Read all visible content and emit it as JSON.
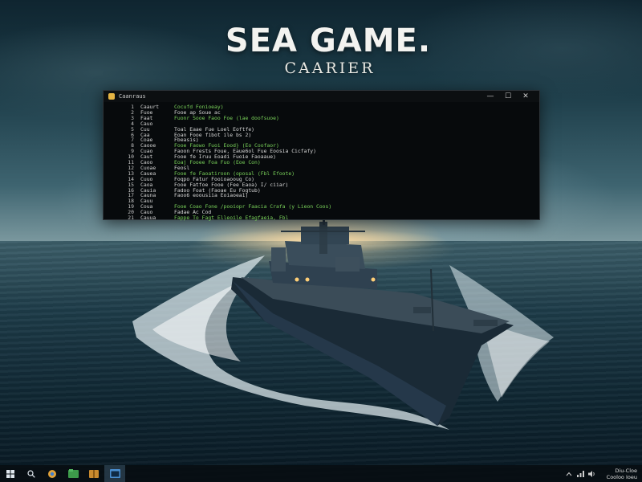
{
  "title": {
    "main": "SEA GAME.",
    "subtitle": "CAARIER"
  },
  "console": {
    "window_title": "Caanraus",
    "controls": {
      "minimize": "—",
      "maximize": "☐",
      "close": "✕"
    },
    "lines": [
      {
        "num": "1",
        "code": "Caaurt",
        "text": "Cocufd Fonioeay)",
        "green": true
      },
      {
        "num": "2",
        "code": "Fuoe",
        "text": "Fooe ap Soue ac",
        "green": false
      },
      {
        "num": "3",
        "code": "Faat",
        "text": "Fuonr Sooe Faoo Foe (lae doofsuoe)",
        "green": true
      },
      {
        "num": "4",
        "code": "Cauo",
        "text": "",
        "green": false
      },
      {
        "num": "5",
        "code": "Cuu",
        "text": "Toal Eaae Fue Loel Eoftfe)",
        "green": false
      },
      {
        "num": "6",
        "code": "Caa",
        "text": "Eoan Fooe fibot ile bs 2)",
        "green": false
      },
      {
        "num": "7",
        "code": "Coae",
        "text": "Fbeasis)",
        "green": false
      },
      {
        "num": "8",
        "code": "Caooe",
        "text": "Fooe Faowo Fuoi Eood} (Eo Coofaor)",
        "green": true
      },
      {
        "num": "9",
        "code": "Cuao",
        "text": "Faoon Frests Foue, Eaue6ol Fue Eoosia Cicfafy)",
        "green": false
      },
      {
        "num": "10",
        "code": "Caut",
        "text": "Fooe fe Iruu Eoadi Fuoie Faoaaue)",
        "green": false
      },
      {
        "num": "11",
        "code": "Caoo",
        "text": "Eoaj Fooee Foa Fuo (Eoe Con)",
        "green": true
      },
      {
        "num": "12",
        "code": "Cuoae",
        "text": "Feosl",
        "green": false
      },
      {
        "num": "13",
        "code": "Cauea",
        "text": "Fooe fe Faoatiroon (oposal (Fbl Efoote)",
        "green": true
      },
      {
        "num": "14",
        "code": "Cuuo",
        "text": "Foqpo Fatur Fooioaooug Co)",
        "green": false
      },
      {
        "num": "15",
        "code": "Caoa",
        "text": "Fooe Fatfoe Fooe (Fee Eaoa) I/ ciiar)",
        "green": false
      },
      {
        "num": "16",
        "code": "Cauia",
        "text": "Fadoo Foat (Faoae Eu Fogtub)",
        "green": false
      },
      {
        "num": "17",
        "code": "Cauna",
        "text": "Faoo6 eoousiia Eoiaoea1)",
        "green": false
      },
      {
        "num": "18",
        "code": "Cauu",
        "text": "",
        "green": false
      },
      {
        "num": "19",
        "code": "Coua",
        "text": "Fooe Coao Fone /pooiopr Faacia Crafa (y Lieon Coos)",
        "green": true
      },
      {
        "num": "20",
        "code": "Cauo",
        "text": "Fadae Ac Cod",
        "green": false
      },
      {
        "num": "21",
        "code": "Cauua",
        "text": "Fappe To Fagt Elleoile Efagfaeia, Fbl",
        "green": true
      }
    ]
  },
  "taskbar": {
    "clock_line1": "Diu-Cloe",
    "clock_line2": "Cooloo Ioeu"
  },
  "colors": {
    "console_bg": "#070a0c",
    "console_green": "#7ad35a",
    "taskbar_bg": "#080e12"
  },
  "icons": {
    "start": "windows-logo-icon",
    "search": "search-icon",
    "apps": [
      "browser-icon",
      "file-manager-icon",
      "archive-icon",
      "console-app-icon"
    ],
    "tray": [
      "chevron-up-icon",
      "network-icon",
      "volume-icon"
    ]
  }
}
